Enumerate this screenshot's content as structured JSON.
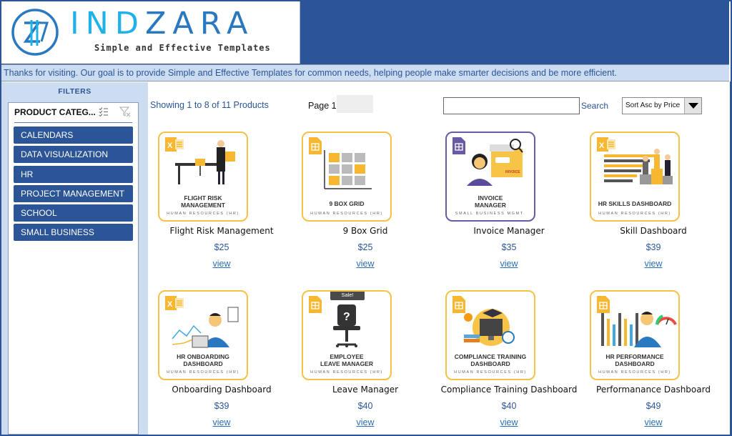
{
  "header": {
    "logo_word_part1": "IND",
    "logo_word_part2": "ZARA",
    "tagline": "Simple and Effective Templates",
    "banner": "Thanks for visiting. Our goal is to provide Simple and Effective Templates for common needs, helping people make smarter decisions and be more efficient."
  },
  "sidebar": {
    "title": "FILTERS",
    "slicer_title": "PRODUCT CATEG...",
    "items": [
      {
        "label": "CALENDARS"
      },
      {
        "label": "DATA VISUALIZATION"
      },
      {
        "label": "HR"
      },
      {
        "label": "PROJECT MANAGEMENT"
      },
      {
        "label": "SCHOOL"
      },
      {
        "label": "SMALL BUSINESS"
      }
    ]
  },
  "toolbar": {
    "showing": "Showing 1 to 8 of 11 Products",
    "page_label": "Page 1",
    "page_value": "",
    "search_value": "",
    "search_label": "Search",
    "sort_value": "Sort Asc by Price"
  },
  "products": [
    {
      "name": "Flight Risk Management",
      "price": "$25",
      "view": "view",
      "thumb_title": "FLIGHT RISK\nMANAGEMENT",
      "thumb_sub": "HUMAN RESOURCES (HR)",
      "app": "excel"
    },
    {
      "name": "9 Box Grid",
      "price": "$25",
      "view": "view",
      "thumb_title": "9 BOX GRID",
      "thumb_sub": "HUMAN RESOURCES (HR)",
      "app": "sheets"
    },
    {
      "name": "Invoice Manager",
      "price": "$35",
      "view": "view",
      "thumb_title": "INVOICE\nMANAGER",
      "thumb_sub": "SMALL BUSINESS MGMT.",
      "app": "sheets",
      "invoice_label": "INVOICE"
    },
    {
      "name": "Skill Dashboard",
      "price": "$39",
      "view": "view",
      "thumb_title": "HR SKILLS DASHBOARD",
      "thumb_sub": "HUMAN RESOURCES (HR)",
      "app": "excel"
    },
    {
      "name": "Onboarding Dashboard",
      "price": "$39",
      "view": "view",
      "thumb_title": "HR ONBOARDING\nDASHBOARD",
      "thumb_sub": "HUMAN RESOURCES (HR)",
      "app": "excel"
    },
    {
      "name": "Leave Manager",
      "price": "$40",
      "view": "view",
      "thumb_title": "EMPLOYEE\nLEAVE MANAGER",
      "thumb_sub": "HUMAN RESOURCES (HR)",
      "app": "sheets",
      "badge": "Sale!"
    },
    {
      "name": "Compliance Training Dashboard",
      "price": "$40",
      "view": "view",
      "thumb_title": "COMPLIANCE TRAINING\nDASHBOARD",
      "thumb_sub": "HUMAN RESOURCES (HR)",
      "app": "sheets"
    },
    {
      "name": "Performanance Dashboard",
      "price": "$49",
      "view": "view",
      "thumb_title": "HR PERFORMANCE\nDASHBOARD",
      "thumb_sub": "HUMAN RESOURCES (HR)",
      "app": "sheets"
    }
  ],
  "colors": {
    "brand_blue": "#2b5597",
    "light_blue": "#cdddf1",
    "card_border": "#f7c147",
    "card_border_alt": "#6a5aa3",
    "logo_cyan": "#1fb2e8",
    "logo_blue": "#2a79c0"
  }
}
